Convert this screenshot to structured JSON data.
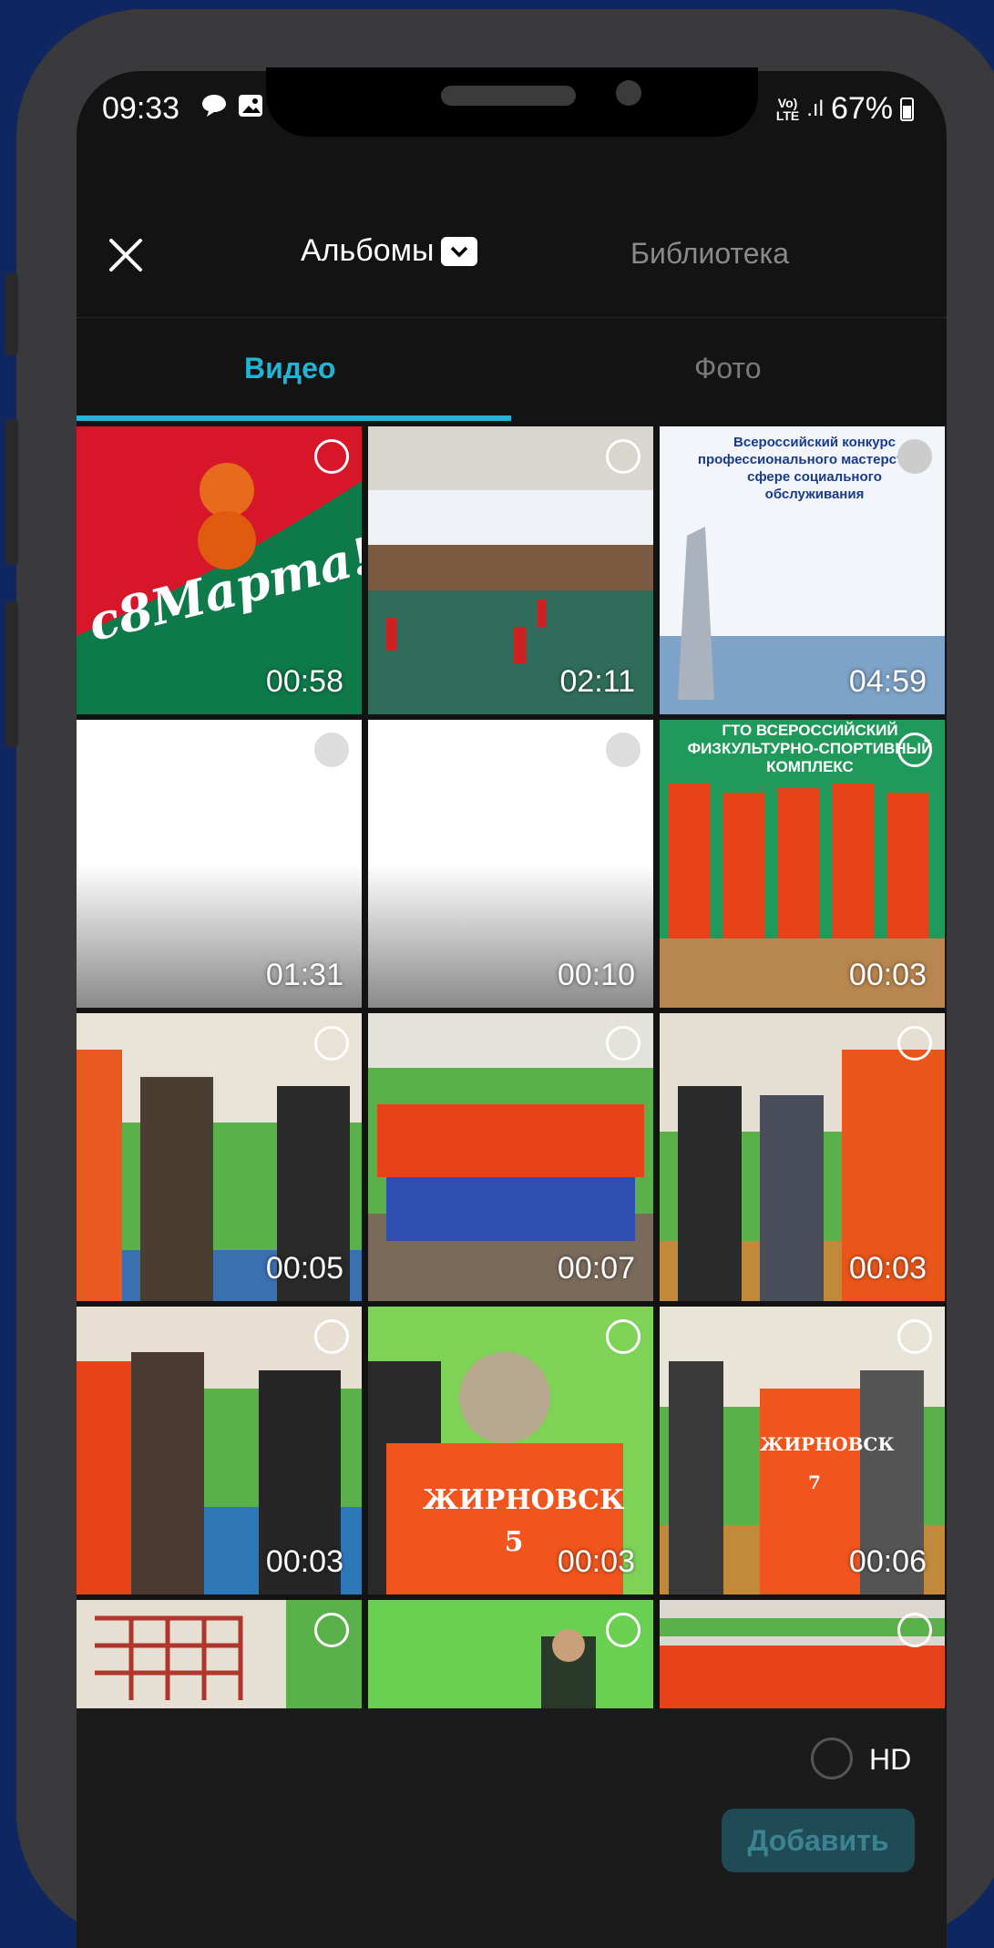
{
  "status_bar": {
    "time": "09:33",
    "network_top": "Vo)",
    "network_bottom": "LTE",
    "signal": ".ıl",
    "battery": "67%"
  },
  "header": {
    "albums_label": "Альбомы",
    "library_label": "Библиотека"
  },
  "tabs": {
    "video_label": "Видео",
    "photo_label": "Фото",
    "active": "Видео",
    "accent_color": "#21b4d6"
  },
  "grid": {
    "items": [
      {
        "duration": "00:58",
        "caption": "с8Марта!"
      },
      {
        "duration": "02:11"
      },
      {
        "duration": "04:59",
        "caption": "Всероссийский конкурс профессионального мастерства в сфере социального обслуживания"
      },
      {
        "duration": "01:31"
      },
      {
        "duration": "00:10"
      },
      {
        "duration": "00:03",
        "caption": "ГТО ВСЕРОССИЙСКИЙ ФИЗКУЛЬТУРНО-СПОРТИВНЫЙ КОМПЛЕКС"
      },
      {
        "duration": "00:05"
      },
      {
        "duration": "00:07"
      },
      {
        "duration": "00:03"
      },
      {
        "duration": "00:03"
      },
      {
        "duration": "00:03",
        "caption": "ЖИРНОВСК 5"
      },
      {
        "duration": "00:06",
        "caption": "ЖИРНОВСК 7"
      },
      {
        "duration": ""
      },
      {
        "duration": ""
      },
      {
        "duration": ""
      }
    ]
  },
  "footer": {
    "hd_label": "HD",
    "add_label": "Добавить"
  }
}
